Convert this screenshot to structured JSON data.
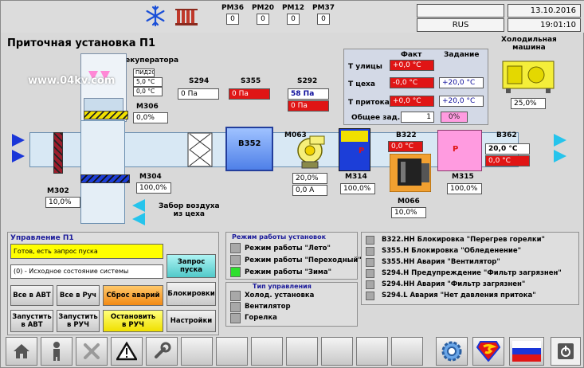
{
  "header": {
    "pm_labels": [
      "PM36",
      "PM20",
      "PM12",
      "PM37"
    ],
    "pm_values": [
      "0",
      "0",
      "0",
      "0"
    ],
    "date": "13.10.2016",
    "time": "19:01:10",
    "language": "RUS"
  },
  "title": "Приточная установка П1",
  "watermark": "www.04kv.com",
  "recuperator": {
    "label": "С рекуператора",
    "pid_label": "ПИД20",
    "pid_value_1": "5,0 °C",
    "pid_value_2": "0,0 °C"
  },
  "sensors": {
    "S294_label": "S294",
    "S294_value": "0 Па",
    "S355_label": "S355",
    "S355_value": "0 Па",
    "S292_label": "S292",
    "S292_value_1": "58 Па",
    "S292_value_2": "0 Па"
  },
  "actuators": {
    "M306_label": "M306",
    "M306_value": "0,0%",
    "M304_label": "M304",
    "M304_value": "100,0%",
    "M302_label": "M302",
    "M302_value": "10,0%",
    "B352_label": "B352",
    "M063_label": "M063",
    "M063_value_1": "20,0%",
    "M063_value_2": "0,0 A",
    "M314_label": "M314",
    "M314_value": "100,0%",
    "B322_label": "B322",
    "B322_value": "0,0 °C",
    "M066_label": "M066",
    "M066_value": "10,0%",
    "M315_label": "M315",
    "M315_value": "100,0%",
    "B362_label": "B362",
    "B362_value_1": "20,0 °C",
    "B362_value_2": "0,0 °C",
    "P_letter": "P"
  },
  "air_intake": "Забор воздуха\nиз цеха",
  "temps": {
    "fact_header": "Факт",
    "setpoint_header": "Задание",
    "outside_label": "Т улицы",
    "outside_fact": "+0,0 °C",
    "shop_label": "Т цеха",
    "shop_fact": "-0,0 °C",
    "shop_set": "+20,0 °C",
    "supply_label": "Т притока",
    "supply_fact": "+0,0 °C",
    "supply_set": "+20,0 °C",
    "common_label": "Общее зад.",
    "common_value": "1",
    "common_percent": "0%"
  },
  "chiller": {
    "label": "Холодильная\nмашина",
    "value": "25,0%"
  },
  "control": {
    "title": "Управление П1",
    "status_1": "Готов, есть запрос пуска",
    "status_2": "(0) - Исходное состояние системы",
    "start_request": "Запрос пуска",
    "all_auto": "Все в АВТ",
    "all_manual": "Все в Руч",
    "reset_alarms": "Сброс аварий",
    "interlocks": "Блокировки",
    "start_auto": "Запустить\nв АВТ",
    "start_manual": "Запустить\nв РУЧ",
    "stop_manual": "Остановить\nв РУЧ",
    "settings": "Настройки"
  },
  "modes": {
    "title": "Режим работы установок",
    "items": [
      "Режим работы \"Лето\"",
      "Режим работы \"Переходный\"",
      "Режим работы \"Зима\""
    ],
    "active": [
      false,
      false,
      true
    ]
  },
  "control_type": {
    "title": "Тип управления",
    "items": [
      "Холод. установка",
      "Вентилятор",
      "Горелка"
    ]
  },
  "alarms": {
    "items": [
      "B322.HH Блокировка \"Перегрев горелки\"",
      "S355.H Блокировка \"Обледенение\"",
      "S355.HH Авария \"Вентилятор\"",
      "S294.H Предупреждение \"Фильтр загрязнен\"",
      "S294.HH Авария \"Фильтр загрязнен\"",
      "S294.L Авария \"Нет давления притока\""
    ]
  },
  "colors": {
    "alarm_red": "#e01515",
    "active_green": "#2ee02e",
    "arrow_blue": "#1a36d8",
    "arrow_cyan": "#26c4ec"
  }
}
